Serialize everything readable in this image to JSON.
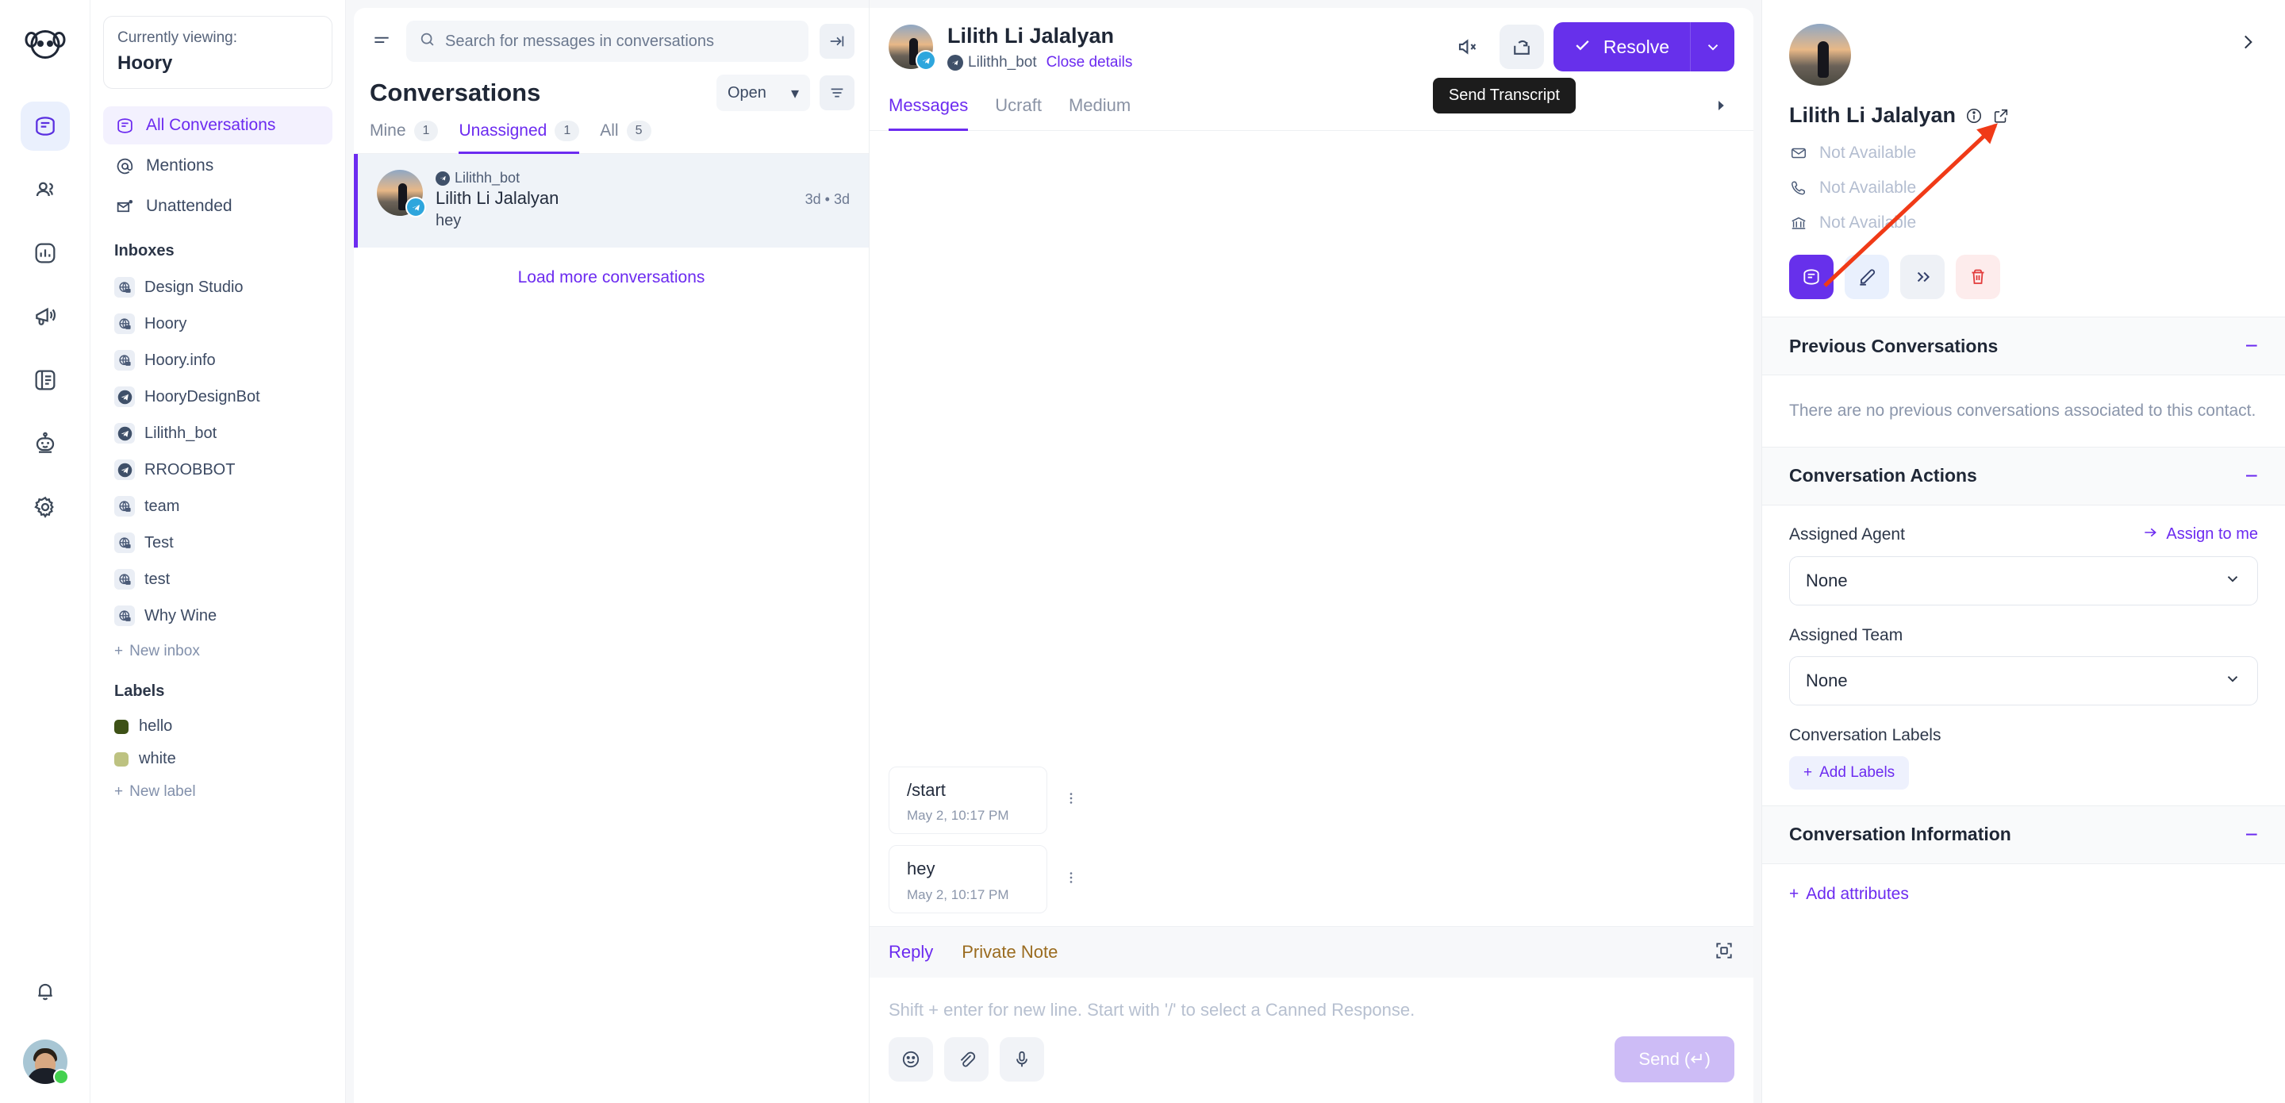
{
  "rail": {
    "logo_icon": "hoory-logo-icon",
    "items": [
      {
        "icon": "conversations-icon",
        "name": "conversations",
        "active": true
      },
      {
        "icon": "contacts-icon",
        "name": "contacts",
        "active": false
      },
      {
        "icon": "reports-icon",
        "name": "reports",
        "active": false
      },
      {
        "icon": "campaigns-icon",
        "name": "campaigns",
        "active": false
      },
      {
        "icon": "help-center-icon",
        "name": "help-center",
        "active": false
      },
      {
        "icon": "bot-icon",
        "name": "bots",
        "active": false
      },
      {
        "icon": "gear-icon",
        "name": "settings",
        "active": false
      }
    ],
    "notifications_icon": "bell-icon",
    "avatar_icon": "user-avatar"
  },
  "sidebar": {
    "viewing_label": "Currently viewing:",
    "viewing_name": "Hoory",
    "nav": [
      {
        "label": "All Conversations",
        "icon": "conversations-icon",
        "active": true
      },
      {
        "label": "Mentions",
        "icon": "at-icon",
        "active": false
      },
      {
        "label": "Unattended",
        "icon": "envelope-dot-icon",
        "active": false
      }
    ],
    "inboxes_title": "Inboxes",
    "inboxes": [
      {
        "label": "Design Studio",
        "channel": "web"
      },
      {
        "label": "Hoory",
        "channel": "web"
      },
      {
        "label": "Hoory.info",
        "channel": "web"
      },
      {
        "label": "HooryDesignBot",
        "channel": "telegram"
      },
      {
        "label": "Lilithh_bot",
        "channel": "telegram"
      },
      {
        "label": "RROOBBOT",
        "channel": "telegram"
      },
      {
        "label": "team",
        "channel": "web"
      },
      {
        "label": "Test",
        "channel": "web"
      },
      {
        "label": "test",
        "channel": "web"
      },
      {
        "label": "Why Wine",
        "channel": "web"
      }
    ],
    "new_inbox_label": "New inbox",
    "labels_title": "Labels",
    "labels": [
      {
        "label": "hello",
        "color": "#3d5116"
      },
      {
        "label": "white",
        "color": "#bdc281"
      }
    ],
    "new_label_label": "New label"
  },
  "conversations": {
    "search_placeholder": "Search for messages in conversations",
    "search_value": "",
    "menu_icon": "hamburger-icon",
    "collapse_icon": "collapse-panel-icon",
    "title": "Conversations",
    "status_filter": "Open",
    "filter_icon": "filter-icon",
    "tabs": [
      {
        "label": "Mine",
        "count": "1",
        "active": false
      },
      {
        "label": "Unassigned",
        "count": "1",
        "active": true
      },
      {
        "label": "All",
        "count": "5",
        "active": false
      }
    ],
    "items": [
      {
        "inbox": "Lilithh_bot",
        "name": "Lilith Li Jalalyan",
        "snippet": "hey",
        "time": "3d • 3d",
        "channel": "telegram",
        "selected": true
      }
    ],
    "load_more_label": "Load more conversations"
  },
  "main": {
    "contact_name": "Lilith Li Jalalyan",
    "inbox_name": "Lilithh_bot",
    "close_details_label": "Close details",
    "mute_icon": "mute-icon",
    "transcript_icon": "send-transcript-icon",
    "tooltip_text": "Send Transcript",
    "resolve_label": "Resolve",
    "resolve_check_icon": "check-icon",
    "resolve_caret_icon": "chevron-down-icon",
    "tabs": [
      {
        "label": "Messages",
        "active": true
      },
      {
        "label": "Ucraft",
        "active": false
      },
      {
        "label": "Medium",
        "active": false
      }
    ],
    "tabs_more_icon": "chevron-right-icon",
    "messages": [
      {
        "text": "/start",
        "time": "May 2, 10:17 PM"
      },
      {
        "text": "hey",
        "time": "May 2, 10:17 PM"
      }
    ],
    "reply": {
      "tabs": [
        {
          "label": "Reply",
          "active": true,
          "kind": "reply"
        },
        {
          "label": "Private Note",
          "active": false,
          "kind": "note"
        }
      ],
      "expand_icon": "expand-icon",
      "placeholder": "Shift + enter for new line. Start with '/' to select a Canned Response.",
      "value": "",
      "tools": [
        {
          "icon": "emoji-icon",
          "name": "emoji-picker"
        },
        {
          "icon": "paperclip-icon",
          "name": "attach-file"
        },
        {
          "icon": "microphone-icon",
          "name": "record-audio"
        }
      ],
      "send_label": "Send (↵)"
    }
  },
  "rightpanel": {
    "expand_icon": "chevron-right-icon",
    "contact_name": "Lilith Li Jalalyan",
    "info_icon": "info-icon",
    "external_icon": "external-link-icon",
    "fields": [
      {
        "icon": "envelope-icon",
        "value": "Not Available",
        "name": "email"
      },
      {
        "icon": "phone-icon",
        "value": "Not Available",
        "name": "phone"
      },
      {
        "icon": "company-icon",
        "value": "Not Available",
        "name": "company"
      }
    ],
    "actions": [
      {
        "icon": "conversations-icon",
        "name": "new-conversation",
        "style": "primary"
      },
      {
        "icon": "pencil-icon",
        "name": "edit-contact",
        "style": "edit"
      },
      {
        "icon": "merge-icon",
        "name": "merge-contact",
        "style": "merge"
      },
      {
        "icon": "trash-icon",
        "name": "delete-contact",
        "style": "del"
      }
    ],
    "previous_conversations": {
      "title": "Previous Conversations",
      "collapse_icon": "−",
      "empty_text": "There are no previous conversations associated to this contact."
    },
    "conversation_actions": {
      "title": "Conversation Actions",
      "collapse_icon": "−",
      "assigned_agent_label": "Assigned Agent",
      "assign_to_me_label": "Assign to me",
      "assigned_agent_value": "None",
      "assigned_team_label": "Assigned Team",
      "assigned_team_value": "None",
      "conversation_labels_label": "Conversation Labels",
      "add_labels_label": "Add Labels"
    },
    "conversation_information": {
      "title": "Conversation Information",
      "collapse_icon": "−",
      "add_attributes_label": "Add attributes"
    }
  },
  "colors": {
    "accent": "#6c2bf0",
    "resolve": "#6730eb",
    "note": "#9a6b1f",
    "danger": "#e23b3b",
    "online": "#44d14f",
    "annotation": "#f03a17"
  }
}
